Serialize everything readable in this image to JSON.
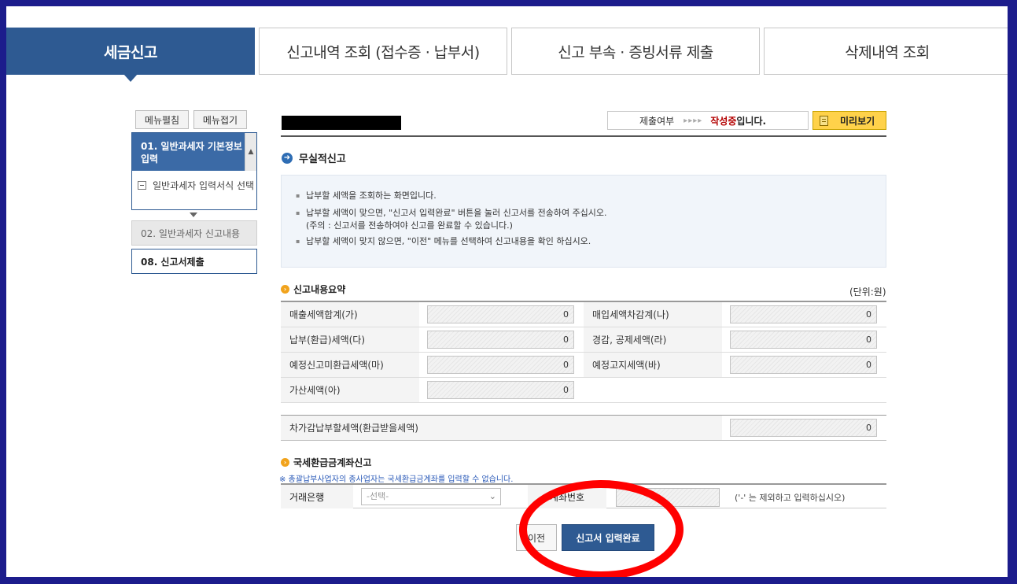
{
  "tabs": [
    {
      "label": "세금신고",
      "active": true
    },
    {
      "label": "신고내역 조회 (접수증 · 납부서)",
      "active": false
    },
    {
      "label": "신고 부속 · 증빙서류 제출",
      "active": false
    },
    {
      "label": "삭제내역 조회",
      "active": false
    }
  ],
  "sidebar": {
    "expand_label": "메뉴펼침",
    "collapse_label": "메뉴접기",
    "step1": "01. 일반과세자 기본정보 입력",
    "step1_sub": "일반과세자 입력서식 선택",
    "step2": "02. 일반과세자 신고내용",
    "step8": "08. 신고서제출"
  },
  "status": {
    "label": "제출여부",
    "arrows": "▸▸▸▸",
    "state": "작성중",
    "suffix": "입니다.",
    "preview_label": "미리보기"
  },
  "section_title": "무실적신고",
  "info": {
    "line1": "납부할 세액을 조회하는 화면입니다.",
    "line2": "납부할 세액이 맞으면, \"신고서 입력완료\" 버튼을 눌러 신고서를 전송하여 주십시오.",
    "line2b": "(주의 : 신고서를 전송하여야 신고를 완료할 수 있습니다.)",
    "line3": "납부할 세액이 맞지 않으면, \"이전\" 메뉴를 선택하여 신고내용을 확인 하십시오."
  },
  "summary": {
    "title": "신고내용요약",
    "unit": "(단위:원)",
    "rows": [
      {
        "l1": "매출세액합계(가)",
        "v1": "0",
        "l2": "매입세액차감계(나)",
        "v2": "0"
      },
      {
        "l1": "납부(환급)세액(다)",
        "v1": "0",
        "l2": "경감, 공제세액(라)",
        "v2": "0"
      },
      {
        "l1": "예정신고미환급세액(마)",
        "v1": "0",
        "l2": "예정고지세액(바)",
        "v2": "0"
      },
      {
        "l1": "가산세액(아)",
        "v1": "0"
      }
    ],
    "total_label": "차가감납부할세액(환급받을세액)",
    "total_value": "0"
  },
  "refund": {
    "title": "국세환급금계좌신고",
    "notice": "※ 총괄납부사업자의 종사업자는 국세환급금계좌를 입력할 수 없습니다.",
    "bank_label": "거래은행",
    "bank_placeholder": "-선택-",
    "account_label": "계좌번호",
    "account_hint": "('-' 는 제외하고 입력하십시오)"
  },
  "buttons": {
    "prev": "이전",
    "submit": "신고서 입력완료"
  },
  "colors": {
    "accent": "#2e5a92",
    "annotation": "#ff0000",
    "preview": "#ffd24a"
  }
}
